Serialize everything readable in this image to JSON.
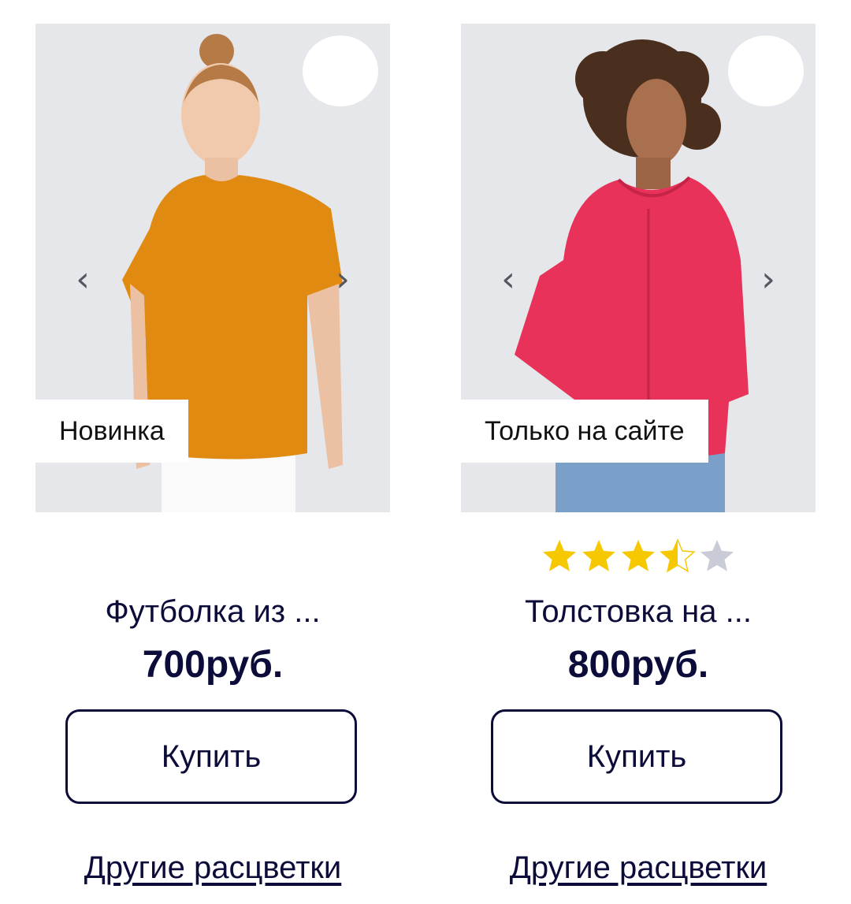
{
  "products": [
    {
      "badge": "Новинка",
      "title": "Футболка из ...",
      "price": "700руб.",
      "buy_label": "Купить",
      "colors_link": "Другие расцветки",
      "prev_arrow": "‹",
      "next_arrow": "›",
      "garment_color": "#e08a12"
    },
    {
      "badge": "Только на сайте",
      "title": "Толстовка на ...",
      "price": "800руб.",
      "buy_label": "Купить",
      "colors_link": "Другие расцветки",
      "prev_arrow": "‹",
      "next_arrow": "›",
      "rating": 3.5,
      "rating_max": 5,
      "garment_color": "#e8325a"
    }
  ],
  "colors": {
    "text": "#0c0c3a",
    "star_filled": "#f5c800",
    "star_empty": "#c9ccd6",
    "photo_bg": "#e6e7eb"
  }
}
